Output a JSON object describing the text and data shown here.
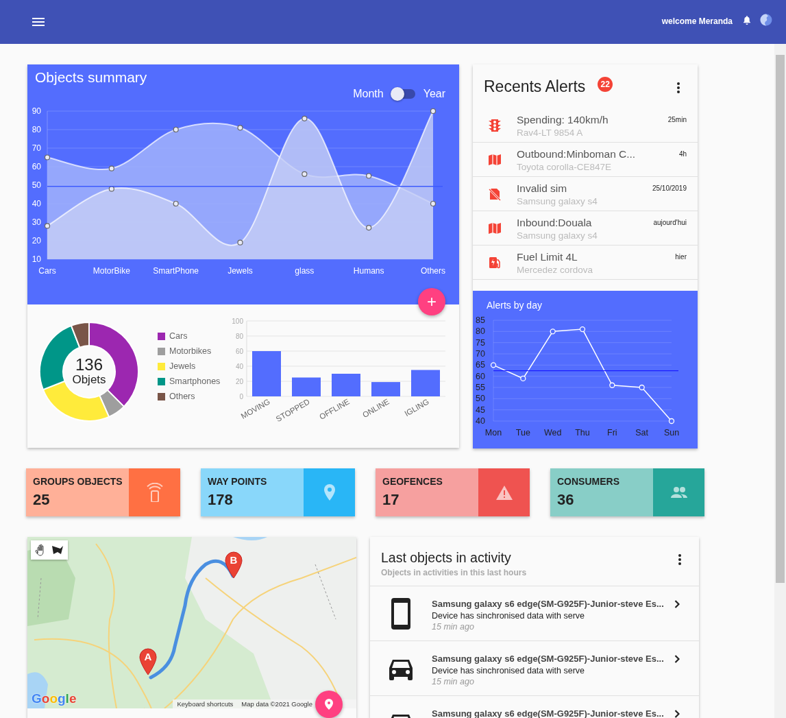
{
  "header": {
    "greeting": "welcome Meranda"
  },
  "objects_summary": {
    "title": "Objects summary",
    "toggle": {
      "left_label": "Month",
      "right_label": "Year",
      "on": false
    },
    "chart_data": {
      "type": "area",
      "categories": [
        "Cars",
        "MotorBike",
        "SmartPhone",
        "Jewels",
        "glass",
        "Humans",
        "Others"
      ],
      "series": [
        {
          "color": "#a3b3fb",
          "marker": "circle",
          "values": [
            65,
            59,
            80,
            81,
            56,
            55,
            40
          ]
        },
        {
          "color": "#c4cdf5",
          "marker": "circle",
          "values": [
            28,
            48,
            40,
            19,
            86,
            27,
            90
          ]
        }
      ],
      "ylim": [
        10,
        90
      ],
      "yticks": [
        10,
        20,
        30,
        40,
        50,
        60,
        70,
        80,
        90
      ],
      "grid": true
    },
    "add_button": "+"
  },
  "objects_breakdown": {
    "center_value": "136",
    "center_label": "Objets",
    "legend": [
      {
        "color": "#9c27b0"
      },
      {
        "color": "#9e9e9e"
      },
      {
        "color": "#ffeb3b"
      },
      {
        "color": "#009688"
      },
      {
        "color": "#795548"
      }
    ],
    "chart_data": {
      "type": "donut",
      "categories": [
        "Cars",
        "Motorbikes",
        "Jewels",
        "Smartphones",
        "Others"
      ],
      "values": [
        37.5,
        5.9,
        25.7,
        25,
        5.9
      ]
    }
  },
  "status_chart": {
    "chart_data": {
      "type": "bar",
      "categories": [
        "MOVING",
        "STOPPED",
        "OFFLINE",
        "ONLINE",
        "IGLING"
      ],
      "values": [
        60,
        25,
        30,
        19,
        35
      ],
      "ylim": [
        0,
        100
      ],
      "yticks": [
        0,
        20,
        40,
        60,
        80,
        100
      ],
      "grid": true
    }
  },
  "alerts": {
    "title": "Recents Alerts",
    "count": "22",
    "items": [
      {
        "title": "Spending: 140km/h",
        "subtitle": "Rav4-LT 9854 A",
        "time": "25min"
      },
      {
        "title": "Outbound:Minboman C...",
        "subtitle": "Toyota corolla-CE847E",
        "time": "4h"
      },
      {
        "title": "Invalid sim",
        "subtitle": "Samsung galaxy s4",
        "time": "25/10/2019"
      },
      {
        "title": "Inbound:Douala",
        "subtitle": "Samsung galaxy s4",
        "time": "aujourd'hui"
      },
      {
        "title": "Fuel Limit 4L",
        "subtitle": "Mercedez cordova",
        "time": "hier"
      }
    ]
  },
  "alerts_by_day": {
    "title": "Alerts by day",
    "chart_data": {
      "type": "line",
      "categories": [
        "Mon",
        "Tue",
        "Wed",
        "Thu",
        "Fri",
        "Sat",
        "Sun"
      ],
      "series": [
        {
          "color": "#ffffff",
          "marker": "circle",
          "values": [
            65,
            59,
            80,
            81,
            56,
            55,
            40
          ]
        }
      ],
      "ylim": [
        40,
        85
      ],
      "yticks": [
        40,
        45,
        50,
        55,
        60,
        65,
        70,
        75,
        80,
        85
      ],
      "grid": true
    }
  },
  "stats": [
    {
      "label": "GROUPS OBJECTS",
      "value": "25",
      "color": "#ff7043"
    },
    {
      "label": "WAY POINTS",
      "value": "178",
      "color": "#29b6f6"
    },
    {
      "label": "GEOFENCES",
      "value": "17",
      "color": "#ef5350"
    },
    {
      "label": "CONSUMERS",
      "value": "36",
      "color": "#26a69a"
    }
  ],
  "map": {
    "markers": [
      {
        "label": "A"
      },
      {
        "label": "B"
      }
    ],
    "logo": "Google",
    "attribution": [
      "Keyboard shortcuts",
      "Map data ©2021 Google"
    ]
  },
  "activity": {
    "title": "Last objects in activity",
    "subtitle": "Objects in activities in this last hours",
    "items": [
      {
        "title": "Samsung galaxy s6 edge(SM-G925F)-Junior-steve Es...",
        "description": "Device has sinchronised data with serve",
        "time": "15 min ago"
      },
      {
        "title": "Samsung galaxy s6 edge(SM-G925F)-Junior-steve Es...",
        "description": "Device has sinchronised data with serve",
        "time": "15 min ago"
      },
      {
        "title": "Samsung galaxy s6 edge(SM-G925F)-Junior-steve Es..."
      }
    ]
  }
}
